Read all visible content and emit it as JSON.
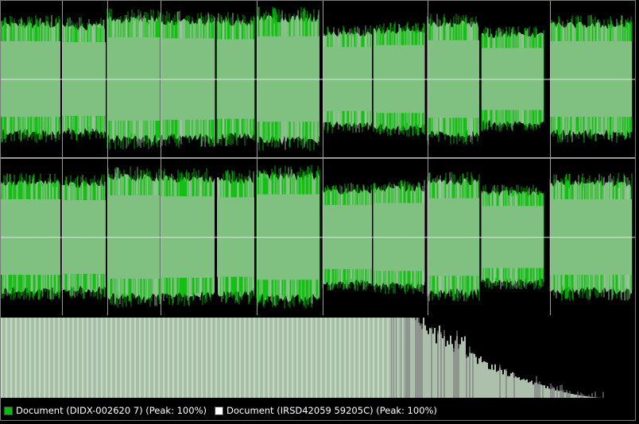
{
  "colors": {
    "background": "#000000",
    "waveform_fill": "#80c080",
    "waveform_doc1": "#00c000",
    "waveform_doc2": "#c8c8c8",
    "grid": "#bfbfbf",
    "spectrum_fill": "#d8f0d8",
    "legend_text": "#ffffff"
  },
  "legend": {
    "items": [
      {
        "label": "Document (DIDX-002620 7) (Peak: 100%)",
        "color": "#00c000",
        "icon": "green-square-icon"
      },
      {
        "label": "Document (IRSD42059 59205C) (Peak: 100%)",
        "color": "#ffffff",
        "icon": "white-square-icon"
      }
    ]
  },
  "waveform": {
    "channels": 2,
    "segment_boundaries_px_note": "",
    "segments": [
      {
        "start": 0.0,
        "end": 0.094,
        "level": 0.78
      },
      {
        "start": 0.097,
        "end": 0.165,
        "level": 0.76
      },
      {
        "start": 0.168,
        "end": 0.25,
        "level": 0.86
      },
      {
        "start": 0.252,
        "end": 0.337,
        "level": 0.84
      },
      {
        "start": 0.341,
        "end": 0.4,
        "level": 0.82
      },
      {
        "start": 0.404,
        "end": 0.502,
        "level": 0.88
      },
      {
        "start": 0.507,
        "end": 0.585,
        "level": 0.66
      },
      {
        "start": 0.588,
        "end": 0.668,
        "level": 0.7
      },
      {
        "start": 0.673,
        "end": 0.755,
        "level": 0.8
      },
      {
        "start": 0.758,
        "end": 0.856,
        "level": 0.64
      },
      {
        "start": 0.866,
        "end": 0.995,
        "level": 0.78
      }
    ],
    "grid_x": [
      0.097,
      0.168,
      0.252,
      0.404,
      0.507,
      0.673,
      0.866
    ]
  },
  "spectrum": {
    "flat_until": 0.64,
    "end": 0.95
  }
}
